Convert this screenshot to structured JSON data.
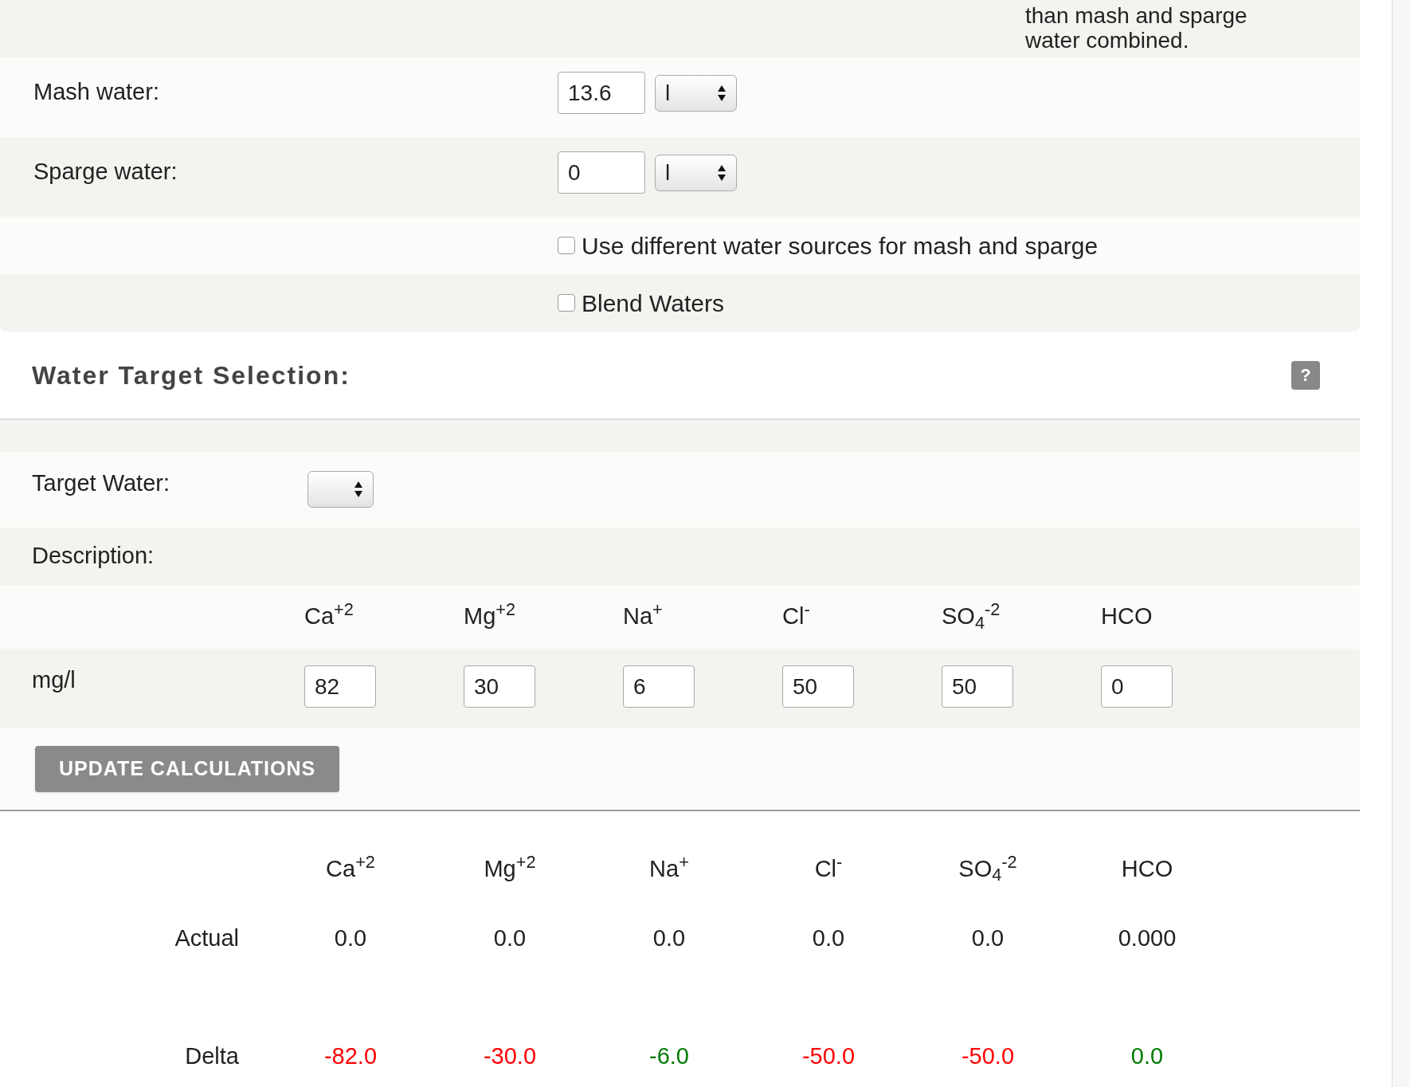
{
  "top_note": "than mash and sparge water combined.",
  "water_rows": [
    {
      "label": "Mash water:",
      "value": "13.6",
      "unit": "l"
    },
    {
      "label": "Sparge water:",
      "value": "0",
      "unit": "l"
    }
  ],
  "options": [
    {
      "label": "Use different water sources for mash and sparge",
      "checked": false
    },
    {
      "label": "Blend Waters",
      "checked": false
    }
  ],
  "section": {
    "title": "Water Target Selection:",
    "help": "?"
  },
  "target_water": {
    "label": "Target Water:"
  },
  "description": {
    "label": "Description:"
  },
  "ions": [
    "Ca$^{+2}$",
    "Mg$^{+2}$",
    "Na$^{+}$",
    "Cl$^{-}$",
    "SO$_{4}$$^{-2}$",
    "HCO"
  ],
  "mg_row": {
    "label": "mg/l",
    "values": [
      "82",
      "30",
      "6",
      "50",
      "50",
      "0"
    ]
  },
  "update_button": "UPDATE CALCULATIONS",
  "results": {
    "columns": [
      "Ca$^{+2}$",
      "Mg$^{+2}$",
      "Na$^{+}$",
      "Cl$^{-}$",
      "SO$_{4}$$^{-2}$",
      "HCO"
    ],
    "rows": [
      {
        "label": "Actual",
        "values": [
          {
            "text": "0.0"
          },
          {
            "text": "0.0"
          },
          {
            "text": "0.0"
          },
          {
            "text": "0.0"
          },
          {
            "text": "0.0"
          },
          {
            "text": "0.000"
          }
        ]
      },
      {
        "label": "Delta",
        "values": [
          {
            "text": "-82.0",
            "color": "#ff0000"
          },
          {
            "text": "-30.0",
            "color": "#ff0000"
          },
          {
            "text": "-6.0",
            "color": "#007a00"
          },
          {
            "text": "-50.0",
            "color": "#ff0000"
          },
          {
            "text": "-50.0",
            "color": "#ff0000"
          },
          {
            "text": "0.0",
            "color": "#007a00"
          }
        ]
      }
    ]
  }
}
